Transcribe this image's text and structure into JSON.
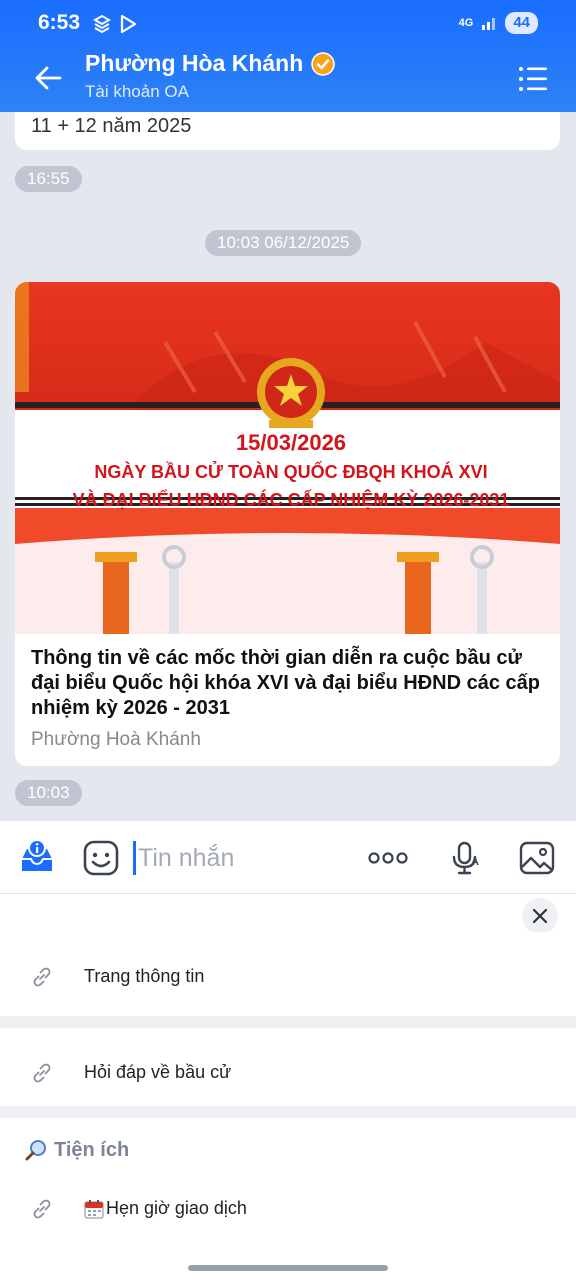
{
  "status_bar": {
    "time": "6:53",
    "network": "4G",
    "battery": "44"
  },
  "header": {
    "title": "Phường Hòa Khánh",
    "subtitle": "Tài khoản OA"
  },
  "chat": {
    "previous_message_text": "11 + 12 năm 2025",
    "previous_time": "16:55",
    "date_separator": "10:03 06/12/2025",
    "article": {
      "banner_date": "15/03/2026",
      "banner_line1": "NGÀY BẦU CỬ TOÀN QUỐC ĐBQH KHOÁ XVI",
      "banner_line2": "VÀ ĐẠI BIỂU HĐND CÁC CẤP NHIỆM KỲ 2026-2031",
      "title": "Thông tin về các mốc thời gian diễn ra cuộc bầu cử đại biểu Quốc hội khóa XVI và đại biểu HĐND các cấp nhiệm kỳ 2026 - 2031",
      "source": "Phường Hoà Khánh"
    },
    "article_time": "10:03"
  },
  "input_bar": {
    "placeholder": "Tin nhắn",
    "more_label": "ooo"
  },
  "quick_menu": {
    "items": [
      {
        "label": "Trang thông tin"
      },
      {
        "label": "Hỏi đáp về bầu cử"
      }
    ],
    "section": {
      "icon": "magnifier-icon",
      "title": "Tiện ích"
    },
    "section_items": [
      {
        "icon": "calendar-icon",
        "label": "Hẹn giờ giao dịch"
      }
    ]
  },
  "colors": {
    "brand": "#1a6dff",
    "banner_red": "#e0301e",
    "banner_text": "#d4141b"
  }
}
